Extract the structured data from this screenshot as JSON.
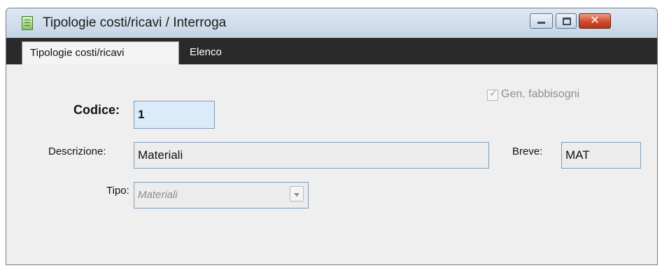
{
  "window": {
    "title": "Tipologie costi/ricavi / Interroga",
    "icon": "document-icon",
    "close_glyph": "✕"
  },
  "tabs": [
    {
      "label": "Tipologie costi/ricavi",
      "active": true
    },
    {
      "label": "Elenco",
      "active": false
    }
  ],
  "form": {
    "codice_label": "Codice:",
    "codice_value": "1",
    "gen_fabbisogni_label": "Gen. fabbisogni",
    "gen_fabbisogni_checked": true,
    "gen_fabbisogni_mark": "✓",
    "descrizione_label": "Descrizione:",
    "descrizione_value": "Materiali",
    "breve_label": "Breve:",
    "breve_value": "MAT",
    "tipo_label": "Tipo:",
    "tipo_value": "Materiali"
  }
}
